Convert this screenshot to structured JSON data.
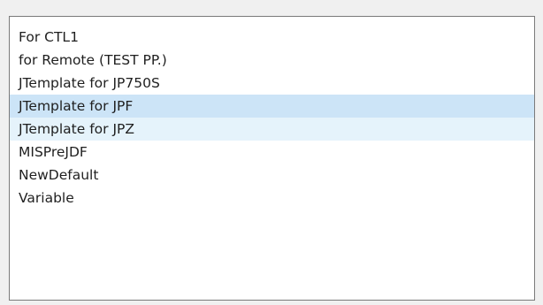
{
  "listbox": {
    "items": [
      {
        "label": "For CTL1",
        "state": "normal"
      },
      {
        "label": "for Remote (TEST PP.)",
        "state": "normal"
      },
      {
        "label": "JTemplate for JP750S",
        "state": "normal"
      },
      {
        "label": "JTemplate for JPF",
        "state": "selected"
      },
      {
        "label": "JTemplate for JPZ",
        "state": "hover"
      },
      {
        "label": "MISPreJDF",
        "state": "normal"
      },
      {
        "label": "NewDefault",
        "state": "normal"
      },
      {
        "label": "Variable",
        "state": "normal"
      }
    ]
  },
  "colors": {
    "window_background": "#f0f0f0",
    "list_background": "#ffffff",
    "list_border": "#7a7a7a",
    "selected_background": "#cce4f7",
    "hover_background": "#e5f3fb",
    "text": "#1f1f1f"
  }
}
